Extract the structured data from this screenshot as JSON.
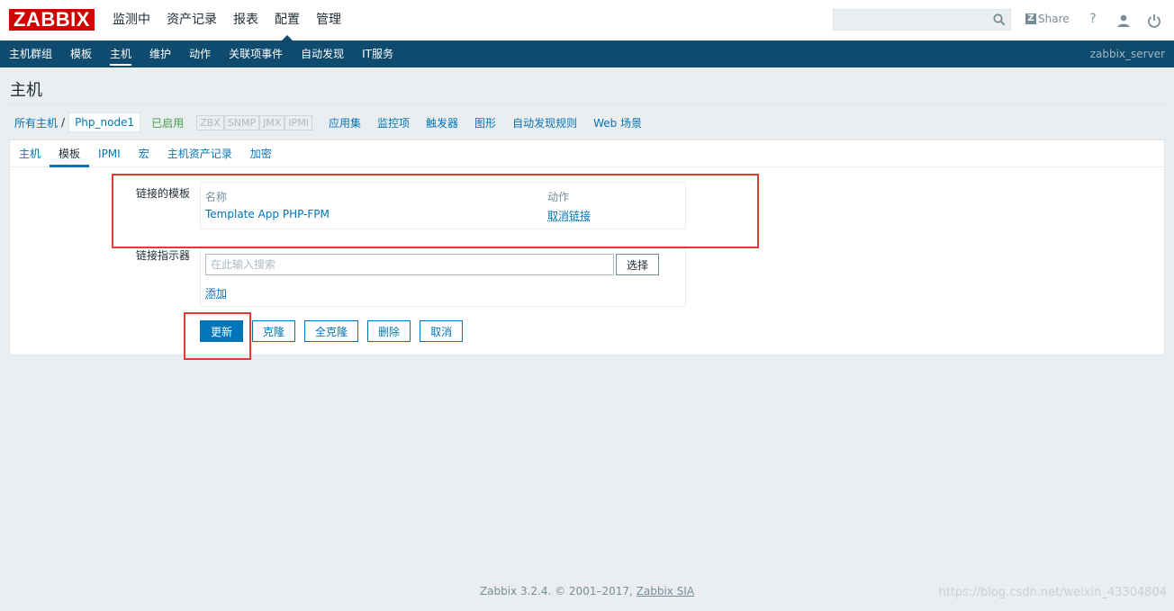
{
  "header": {
    "logo": "ZABBIX",
    "nav": [
      "监测中",
      "资产记录",
      "报表",
      "配置",
      "管理"
    ],
    "nav_active": 3,
    "search_placeholder": "",
    "share_label": "Share",
    "help_icon": "?"
  },
  "subnav": {
    "items": [
      "主机群组",
      "模板",
      "主机",
      "维护",
      "动作",
      "关联项事件",
      "自动发现",
      "IT服务"
    ],
    "active": 2,
    "server": "zabbix_server"
  },
  "page": {
    "title": "主机"
  },
  "hostbar": {
    "all_hosts": "所有主机",
    "separator": "/",
    "host": "Php_node1",
    "status": "已启用",
    "availability": [
      "ZBX",
      "SNMP",
      "JMX",
      "IPMI"
    ],
    "links": [
      "应用集",
      "监控项",
      "触发器",
      "图形",
      "自动发现规则",
      "Web 场景"
    ]
  },
  "tabs": {
    "items": [
      "主机",
      "模板",
      "IPMI",
      "宏",
      "主机资产记录",
      "加密"
    ],
    "active": 1
  },
  "form": {
    "linked_templates_label": "链接的模板",
    "col_name": "名称",
    "col_action": "动作",
    "template_name": "Template App PHP-FPM",
    "unlink": "取消链接",
    "link_new_label": "链接指示器",
    "search_placeholder": "在此输入搜索",
    "select_button": "选择",
    "add_link": "添加"
  },
  "buttons": {
    "update": "更新",
    "clone": "克隆",
    "full_clone": "全克隆",
    "delete": "删除",
    "cancel": "取消"
  },
  "footer": {
    "text": "Zabbix 3.2.4. © 2001–2017,",
    "company": "Zabbix SIA",
    "watermark": "https://blog.csdn.net/weixin_43304804"
  },
  "colors": {
    "brand_red": "#d40000",
    "nav_blue": "#0e4b6e",
    "link_blue": "#0275b8",
    "enabled_green": "#429e47",
    "highlight_red": "#e53935"
  }
}
